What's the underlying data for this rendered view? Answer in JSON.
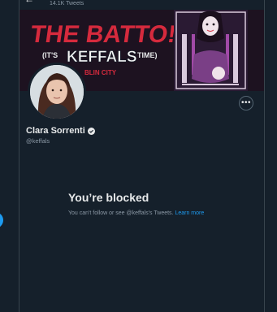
{
  "header": {
    "back_icon": "arrow-left-icon",
    "tweet_count": "14.1K Tweets"
  },
  "banner": {
    "line1": "THE BATTO!",
    "line2_left": "(IT'S",
    "line2_mid": "KEFFALS",
    "line2_right": "TIME)",
    "line3": "BLIN CITY",
    "colors": {
      "bg": "#1d1220",
      "red": "#d62a3d",
      "pink": "#a24aa8"
    }
  },
  "profile": {
    "name": "Clara Sorrenti",
    "handle": "@keffals",
    "verified_icon": "verified-badge-icon",
    "more_icon": "more-icon",
    "more_label": "•••"
  },
  "blocked": {
    "title": "You’re blocked",
    "desc_prefix": "You can't follow or see @keffals's Tweets.",
    "learn_more": "Learn more"
  },
  "colors": {
    "background": "#15202b",
    "accent": "#1d9bf0",
    "muted": "#8b98a5"
  }
}
